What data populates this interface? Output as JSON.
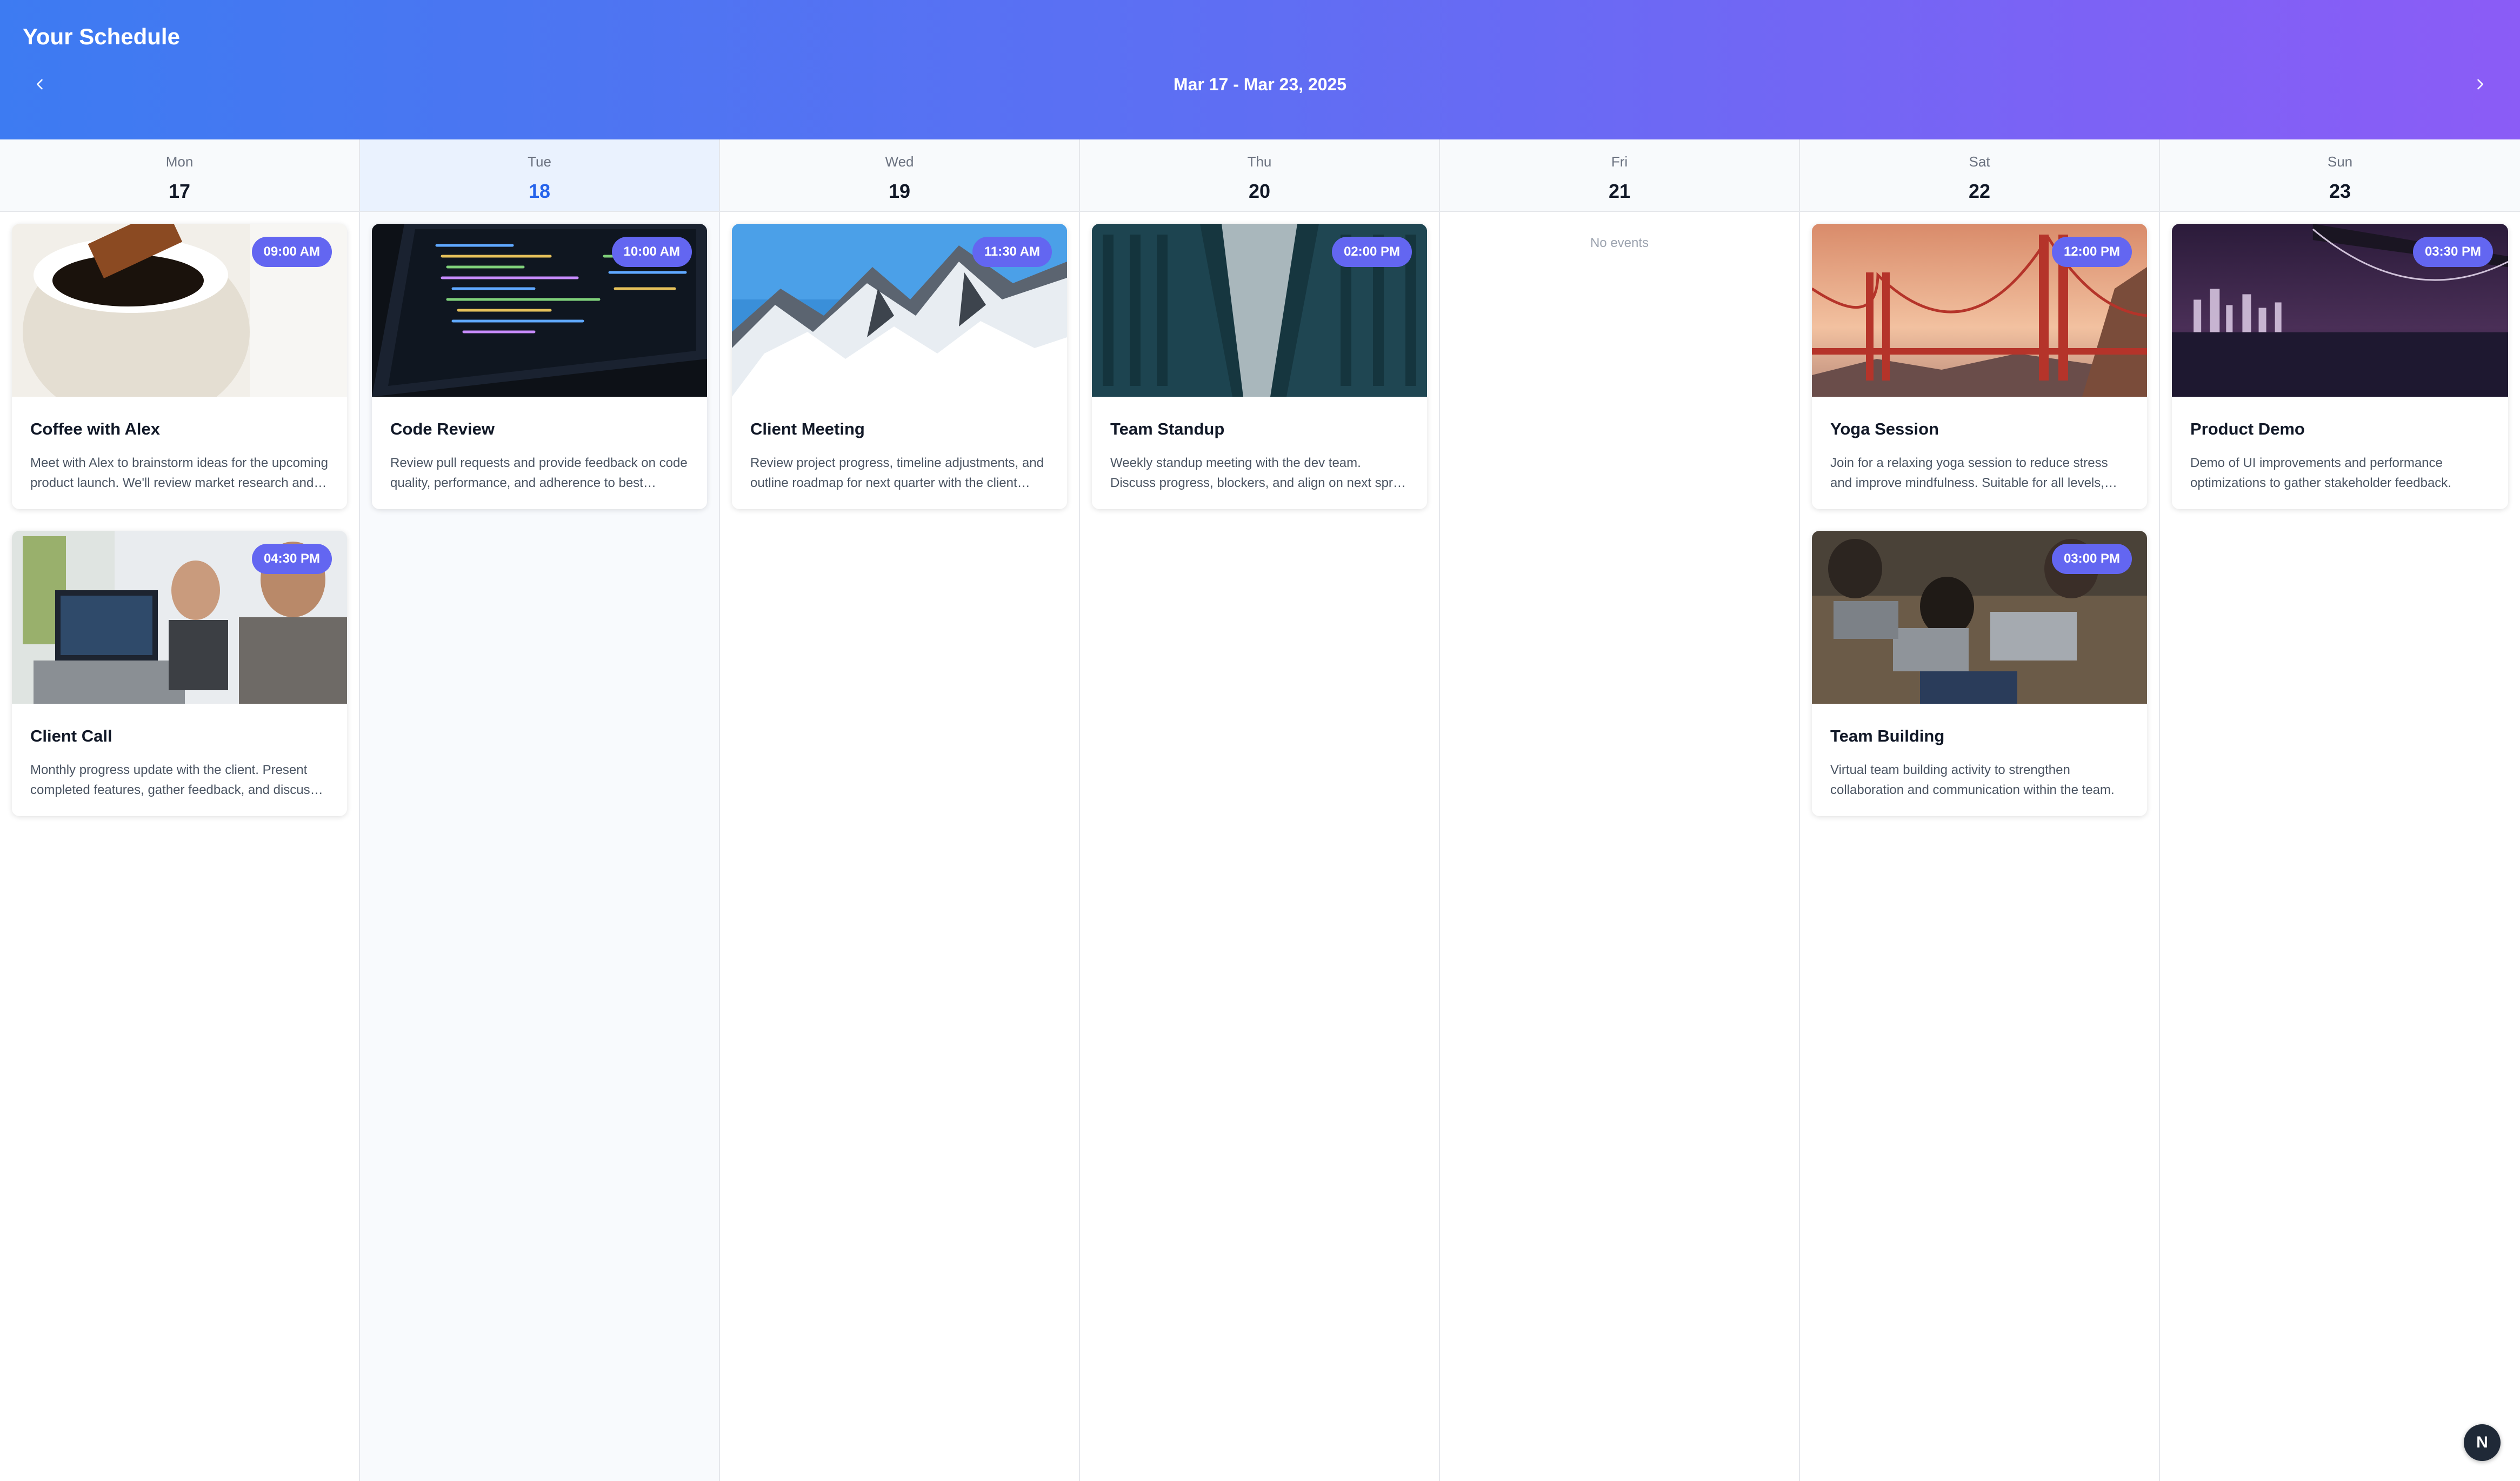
{
  "header": {
    "title": "Your Schedule",
    "range": "Mar 17 - Mar 23, 2025",
    "prev_icon": "chevron-left-icon",
    "next_icon": "chevron-right-icon"
  },
  "days": [
    {
      "name": "Mon",
      "num": "17"
    },
    {
      "name": "Tue",
      "num": "18"
    },
    {
      "name": "Wed",
      "num": "19"
    },
    {
      "name": "Thu",
      "num": "20"
    },
    {
      "name": "Fri",
      "num": "21",
      "empty_text": "No events"
    },
    {
      "name": "Sat",
      "num": "22"
    },
    {
      "name": "Sun",
      "num": "23"
    }
  ],
  "events": {
    "mon": [
      {
        "time": "09:00 AM",
        "title": "Coffee with Alex",
        "desc": "Meet with Alex to brainstorm ideas for the upcoming product launch. We'll review market research and competitor analysis."
      },
      {
        "time": "04:30 PM",
        "title": "Client Call",
        "desc": "Monthly progress update with the client. Present completed features, gather feedback, and discuss next steps."
      }
    ],
    "tue": [
      {
        "time": "10:00 AM",
        "title": "Code Review",
        "desc": "Review pull requests and provide feedback on code quality, performance, and adherence to best practices."
      }
    ],
    "wed": [
      {
        "time": "11:30 AM",
        "title": "Client Meeting",
        "desc": "Review project progress, timeline adjustments, and outline roadmap for next quarter with the client team."
      }
    ],
    "thu": [
      {
        "time": "02:00 PM",
        "title": "Team Standup",
        "desc": "Weekly standup meeting with the dev team. Discuss progress, blockers, and align on next sprint goals."
      }
    ],
    "sat": [
      {
        "time": "12:00 PM",
        "title": "Yoga Session",
        "desc": "Join for a relaxing yoga session to reduce stress and improve mindfulness. Suitable for all levels, mats provided."
      },
      {
        "time": "03:00 PM",
        "title": "Team Building",
        "desc": "Virtual team building activity to strengthen collaboration and communication within the team."
      }
    ],
    "sun": [
      {
        "time": "03:30 PM",
        "title": "Product Demo",
        "desc": "Demo of UI improvements and performance optimizations to gather stakeholder feedback."
      }
    ]
  },
  "fab": {
    "label": "N"
  },
  "colors": {
    "accent": "#6366f1",
    "today": "#2563eb"
  }
}
